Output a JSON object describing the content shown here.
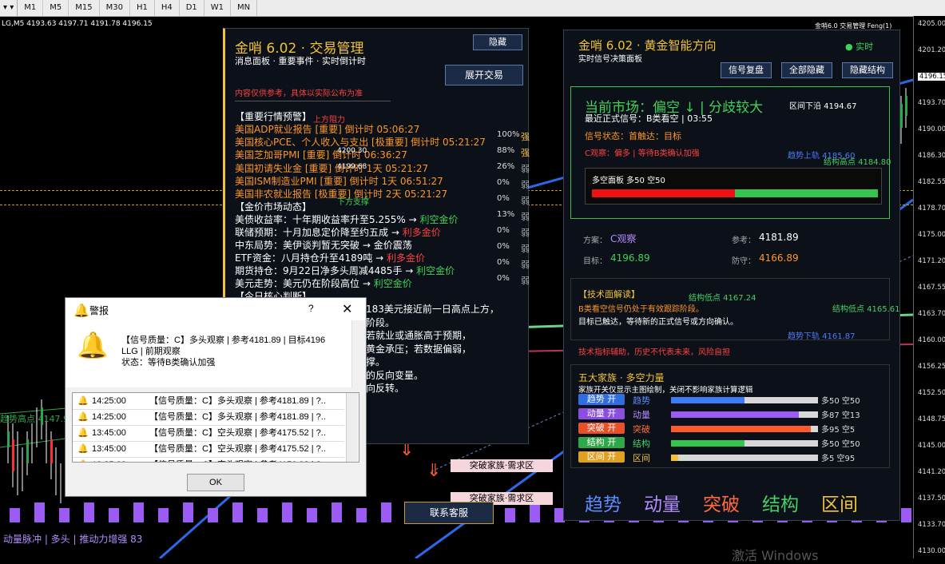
{
  "toolbar": {
    "symbol_select": "LG,M5",
    "timeframes": [
      "M1",
      "M5",
      "M15",
      "M30",
      "H1",
      "H4",
      "D1",
      "W1",
      "MN"
    ]
  },
  "chart": {
    "symbol_line": "LG,M5  4193.63 4197.71 4191.78 4196.15",
    "indicator_name": "金哨6.0 交易管理  Feng(1)",
    "price_ticks": [
      "4205.00",
      "4201.20",
      "4196.15",
      "4193.70",
      "4190.00",
      "4186.30",
      "4182.55",
      "4178.70",
      "4175.00",
      "4171.20",
      "4167.55",
      "4163.70",
      "4160.00",
      "4156.25",
      "4152.50",
      "4148.75",
      "4145.00",
      "4141.20",
      "4137.50",
      "4133.70",
      "4130.00"
    ],
    "current_price": "4196.15",
    "left_label": "趋势高点 4147.99",
    "bottom_left": "动量脉冲 | 多头 | 推动力增强 83",
    "zone1": "突破家族·需求区",
    "zone2": "突破家族·需求区",
    "contact": "联系客服",
    "watermark": "EAHub.cn",
    "chart_labels": {
      "upper_res": "上方阻力",
      "t1": "4200.30",
      "t2": "4199.68",
      "support": "下方支撑",
      "tr_up": "趋势上轨 4185.60",
      "struct_high": "结构高点 4184.80",
      "struct_low": "结构低点 4167.24",
      "struct_low2": "结构低点 4165.61",
      "tr_down": "趋势下轨 4161.87"
    },
    "activate": "激活 Windows"
  },
  "trade_panel": {
    "title": "金哨 6.02 · 交易管理",
    "subtitle": "消息面板 · 重要事件 · 实时倒计时",
    "hide_btn": "隐藏",
    "expand_btn": "展开交易",
    "disclaimer": "内容仅供参考，具体以实际公布为准",
    "alerts_header": "【重要行情预警】",
    "alerts": [
      "美国ADP就业报告 [重要] 倒计时 05:06:27",
      "美国核心PCE、个人收入与支出 [极重要] 倒计时 05:21:27",
      "美国芝加哥PMI [重要] 倒计时 06:36:27",
      "美国初请失业金 [重要] 倒计时 1天 05:21:27",
      "美国ISM制造业PMI [重要] 倒计时 1天 06:51:27",
      "美国非农就业报告 [极重要] 倒计时 2天 05:21:27"
    ],
    "pcts": [
      {
        "v": "100%",
        "l": "强"
      },
      {
        "v": "88%",
        "l": "强"
      },
      {
        "v": "26%",
        "l": "弱"
      },
      {
        "v": "0%",
        "l": "弱"
      },
      {
        "v": "0%",
        "l": "弱"
      },
      {
        "v": "13%",
        "l": "弱"
      },
      {
        "v": "0%",
        "l": "弱"
      },
      {
        "v": "0%",
        "l": "弱"
      },
      {
        "v": "0%",
        "l": "弱"
      },
      {
        "v": "0%",
        "l": "弱"
      }
    ],
    "market_header": "【金价市场动态】",
    "market": [
      {
        "t": "美债收益率：十年期收益率升至5.255% → ",
        "r": "利空金价",
        "c": "green"
      },
      {
        "t": "联储预期：十月加息定价降至约五成 → ",
        "r": "利多金价",
        "c": "red"
      },
      {
        "t": "中东局势：美伊谈判暂无突破 → ",
        "r": "金价震荡",
        "c": "white"
      },
      {
        "t": "ETF资金：八月持仓升至4189吨 → ",
        "r": "利多金价",
        "c": "red"
      },
      {
        "t": "期货持仓：9月22日净多头周减4485手 → ",
        "r": "利空金价",
        "c": "green"
      },
      {
        "t": "美元走势：美元仍在阶段高位 → ",
        "r": "利空金价",
        "c": "green"
      }
    ],
    "judge_header": "【今日核心判断】",
    "judge_lines": [
      "183美元接近前一日高点上方，",
      "阶段。",
      "若就业或通胀高于预期，",
      "黄金承压；若数据偏弱，",
      "撑。",
      "的反向变量。",
      "向反转。"
    ]
  },
  "signal_panel": {
    "title": "金哨 6.02 · 黄金智能方向",
    "subtitle": "实时信号决策面板",
    "live": "● 实时",
    "btns": [
      "信号复盘",
      "全部隐藏",
      "隐藏结构"
    ],
    "market_state": "当前市场：偏空 ↓ | 分歧较大",
    "range_low": "区间下沿 4194.67",
    "formal_signal": "最近正式信号：B类看空 | 03:55",
    "signal_status": "信号状态：首触达：目标",
    "observe": "C观察：偏多 | 等待B类确认加强",
    "long_short_label": "多空面板  多50 空50",
    "long_pct": 0.5,
    "plan_label": "方案：",
    "plan_value": "C观察",
    "ref_label": "参考：",
    "ref_value": "4181.89",
    "target_label": "目标：",
    "target_value": "4196.89",
    "defense_label": "防守：",
    "defense_value": "4166.89",
    "tech_header": "【技术面解读】",
    "tech_lines": [
      "B类看空信号仍处于有效跟踪阶段。",
      "目标已触达，等待新的正式信号或方向确认。"
    ],
    "tech_note": "技术指标辅助，历史不代表未来，风险自担",
    "families_title": "五大家族 · 多空力量",
    "families_sub": "家族开关仅显示主图绘制，关闭不影响家族计算逻辑",
    "families": [
      {
        "tag": "趋势 开",
        "name": "趋势",
        "tagColor": "#2f6de0",
        "nameColor": "#5b8cff",
        "fill": 0.5,
        "fillColor": "#3b7cf5",
        "val": "多50 空50"
      },
      {
        "tag": "动量 开",
        "name": "动量",
        "tagColor": "#8b4fe0",
        "nameColor": "#b38cff",
        "fill": 0.87,
        "fillColor": "#9a5cf5",
        "val": "多87 空13"
      },
      {
        "tag": "突破 开",
        "name": "突破",
        "tagColor": "#e8502a",
        "nameColor": "#ff6a3d",
        "fill": 0.95,
        "fillColor": "#ff5a2e",
        "val": "多95 空5"
      },
      {
        "tag": "结构 开",
        "name": "结构",
        "tagColor": "#2fa84a",
        "nameColor": "#45d065",
        "fill": 0.5,
        "fillColor": "#35c54f",
        "val": "多50 空50"
      },
      {
        "tag": "区间 开",
        "name": "区间",
        "tagColor": "#e0a020",
        "nameColor": "#f2c237",
        "fill": 0.05,
        "fillColor": "#f2c237",
        "val": "多5 空95"
      }
    ],
    "big_labels": [
      {
        "t": "趋势",
        "c": "#5b8cff"
      },
      {
        "t": "动量",
        "c": "#b38cff"
      },
      {
        "t": "突破",
        "c": "#ff6a3d"
      },
      {
        "t": "结构",
        "c": "#45d065"
      },
      {
        "t": "区间",
        "c": "#f2c237"
      }
    ]
  },
  "alert_dialog": {
    "title": "警报",
    "message": [
      "【信号质量：C】多头观察 | 参考4181.89 | 目标4196",
      "LLG | 前期观察",
      "状态：等待B类确认加强"
    ],
    "rows": [
      {
        "time": "14:25:00",
        "text": "【信号质量：C】多头观察 | 参考4181.89 | ?.."
      },
      {
        "time": "14:25:00",
        "text": "【信号质量：C】多头观察 | 参考4181.89 | ?.."
      },
      {
        "time": "13:45:00",
        "text": "【信号质量：C】空头观察 | 参考4175.52 | ?.."
      },
      {
        "time": "13:45:00",
        "text": "【信号质量：C】空头观察 | 参考4175.52 | ?.."
      },
      {
        "time": "13:25:00",
        "text": "【信号质量：C】空头观察 | 参考4170.92 | ?.."
      }
    ],
    "ok": "OK"
  }
}
